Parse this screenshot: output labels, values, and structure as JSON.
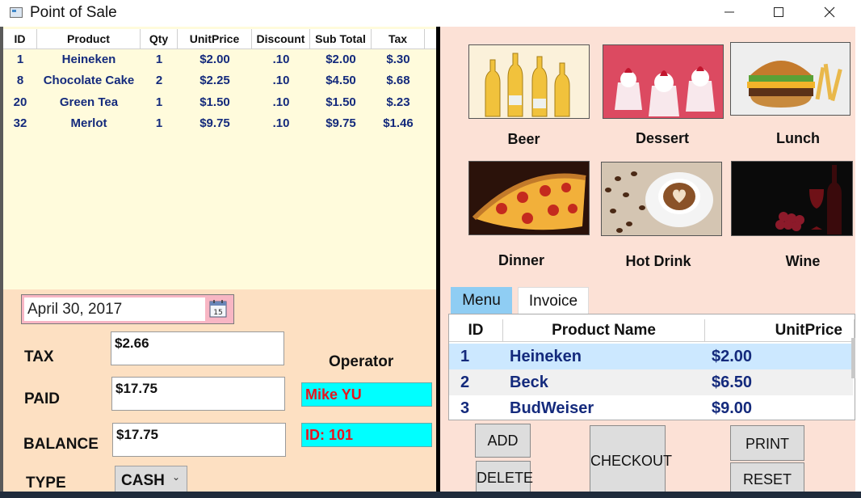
{
  "window": {
    "title": "Point of Sale"
  },
  "order": {
    "columns": [
      "ID",
      "Product",
      "Qty",
      "UnitPrice",
      "Discount",
      "Sub Total",
      "Tax"
    ],
    "rows": [
      [
        "1",
        "Heineken",
        "1",
        "$2.00",
        ".10",
        "$2.00",
        "$.30"
      ],
      [
        "8",
        "Chocolate Cake",
        "2",
        "$2.25",
        ".10",
        "$4.50",
        "$.68"
      ],
      [
        "20",
        "Green Tea",
        "1",
        "$1.50",
        ".10",
        "$1.50",
        "$.23"
      ],
      [
        "32",
        "Merlot",
        "1",
        "$9.75",
        ".10",
        "$9.75",
        "$1.46"
      ]
    ]
  },
  "payment": {
    "date": "April 30, 2017",
    "calendar_day": "15",
    "tax_label": "TAX",
    "tax_value": "$2.66",
    "paid_label": "PAID",
    "paid_value": "$17.75",
    "balance_label": "BALANCE",
    "balance_value": "$17.75",
    "type_label": "TYPE",
    "type_value": "CASH",
    "operator_label": "Operator",
    "operator_name": "Mike YU",
    "operator_id": "ID: 101"
  },
  "categories": [
    {
      "label": "Beer",
      "icon": "beer-photo"
    },
    {
      "label": "Dessert",
      "icon": "dessert-photo"
    },
    {
      "label": "Lunch",
      "icon": "burger-photo"
    },
    {
      "label": "Dinner",
      "icon": "pizza-photo"
    },
    {
      "label": "Hot Drink",
      "icon": "coffee-photo"
    },
    {
      "label": "Wine",
      "icon": "wine-photo"
    }
  ],
  "tabs": {
    "menu": "Menu",
    "invoice": "Invoice"
  },
  "menu_grid": {
    "columns": [
      "ID",
      "Product Name",
      "UnitPrice"
    ],
    "rows": [
      [
        "1",
        "Heineken",
        "$2.00"
      ],
      [
        "2",
        "Beck",
        "$6.50"
      ],
      [
        "3",
        "BudWeiser",
        "$9.00"
      ]
    ]
  },
  "buttons": {
    "add": "ADD",
    "delete": "DELETE",
    "checkout": "CHECKOUT",
    "print": "PRINT",
    "reset": "RESET"
  },
  "colors": {
    "order_bg": "#fffbdc",
    "payment_bg": "#fde0c2",
    "right_bg": "#fce1d6",
    "operator_bg": "#00ffff",
    "operator_text": "#e8141e",
    "row_text": "#142a7c",
    "selected_row": "#cce8ff",
    "active_tab": "#8fcdf3"
  }
}
